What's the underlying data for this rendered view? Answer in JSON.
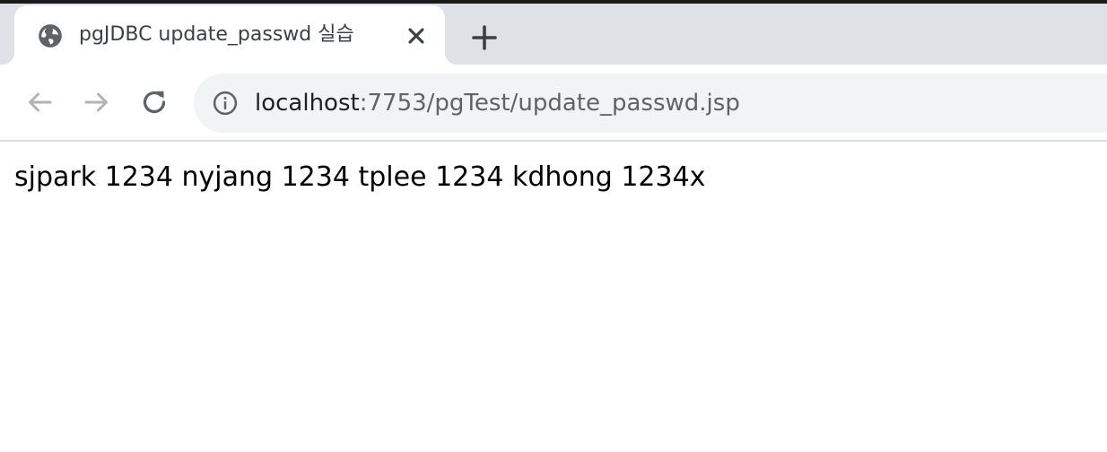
{
  "browser": {
    "tab": {
      "title": "pgJDBC update_passwd 실습",
      "favicon": "globe-icon",
      "close_icon": "close-icon"
    },
    "new_tab_icon": "plus-icon",
    "toolbar": {
      "back_icon": "back-arrow-icon",
      "forward_icon": "forward-arrow-icon",
      "reload_icon": "reload-icon"
    },
    "address_bar": {
      "info_icon": "info-icon",
      "host": "localhost",
      "path": ":7753/pgTest/update_passwd.jsp"
    }
  },
  "page": {
    "body_text": "sjpark 1234 nyjang 1234 tplee 1234 kdhong 1234x"
  },
  "colors": {
    "tabstrip_bg": "#dee1e6",
    "omnibox_bg": "#f1f3f4",
    "icon_dark": "#5f6368",
    "icon_disabled": "#b1b3b6"
  }
}
